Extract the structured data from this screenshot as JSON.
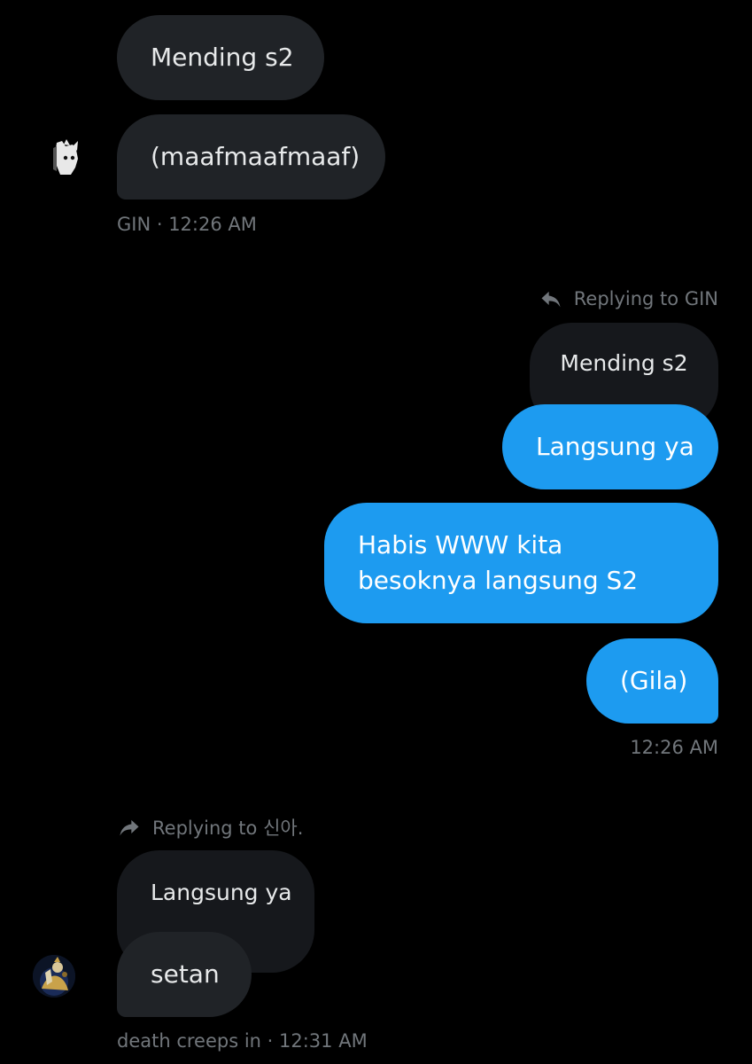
{
  "messages": {
    "gin_1": "Mending s2",
    "gin_2": "(maafmaafmaaf)",
    "gin_meta": "GIN · 12:26 AM",
    "reply_to_gin": "Replying to GIN",
    "quoted_gin": "Mending s2",
    "me_1": "Langsung ya",
    "me_2": "Habis WWW kita besoknya langsung S2",
    "me_3": "(Gila)",
    "me_meta": "12:26 AM",
    "reply_to_sina": "Replying to 신아.",
    "quoted_me": "Langsung ya",
    "death_1": "setan",
    "death_meta": "death creeps in · 12:31 AM"
  },
  "icons": {
    "reply_out": "reply-arrow-icon",
    "reply_in": "forward-arrow-icon"
  },
  "colors": {
    "background": "#000000",
    "incoming_bubble": "#202327",
    "quoted_bubble": "#16181c",
    "outgoing_bubble": "#1d9bf0",
    "meta_text": "#71767b"
  }
}
